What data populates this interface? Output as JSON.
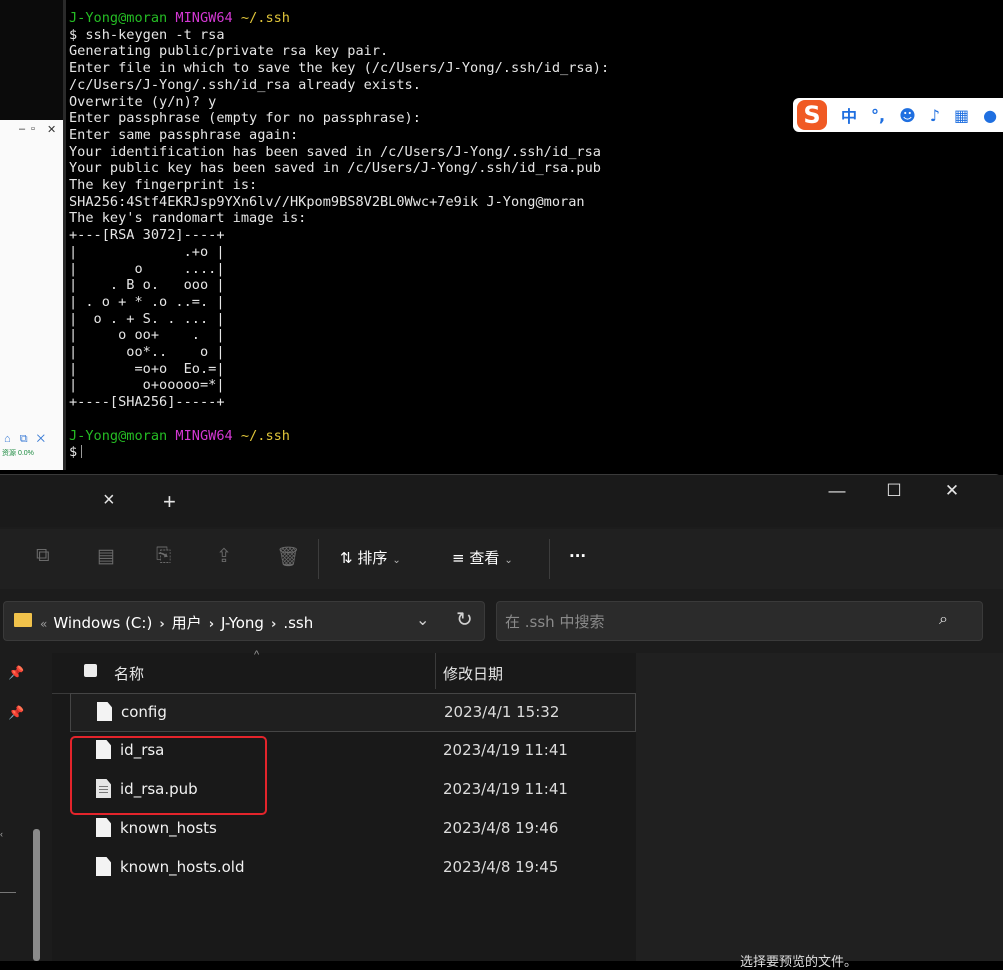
{
  "terminal": {
    "prompt_user": "J-Yong@moran",
    "prompt_host": "MINGW64",
    "prompt_path": "~/.ssh",
    "lines": [
      "$ ssh-keygen -t rsa",
      "Generating public/private rsa key pair.",
      "Enter file in which to save the key (/c/Users/J-Yong/.ssh/id_rsa):",
      "/c/Users/J-Yong/.ssh/id_rsa already exists.",
      "Overwrite (y/n)? y",
      "Enter passphrase (empty for no passphrase):",
      "Enter same passphrase again:",
      "Your identification has been saved in /c/Users/J-Yong/.ssh/id_rsa",
      "Your public key has been saved in /c/Users/J-Yong/.ssh/id_rsa.pub",
      "The key fingerprint is:",
      "SHA256:4Stf4EKRJsp9YXn6lv//HKpom9BS8V2BL0Wwc+7e9ik J-Yong@moran",
      "The key's randomart image is:",
      "+---[RSA 3072]----+",
      "|             .+o |",
      "|       o     ....|",
      "|    . B o.   ooo |",
      "| . o + * .o ..=. |",
      "|  o . + S. . ... |",
      "|     o oo+    .  |",
      "|      oo*..    o |",
      "|       =o+o  Eo.=|",
      "|        o+ooooo=*|",
      "+----[SHA256]-----+"
    ],
    "second_prompt_symbol": "$"
  },
  "ime": {
    "logo": "S",
    "mode": "中",
    "punct": "°,",
    "emoji_icon": "emoji-icon",
    "mic_icon": "microphone-icon",
    "keyboard_icon": "keyboard-icon"
  },
  "left_window": {
    "cpu": "资源 0.0%"
  },
  "explorer": {
    "tab_close": "×",
    "tab_new": "+",
    "window": {
      "minimize": "—",
      "maximize": "☐",
      "close": "✕"
    },
    "toolbar": {
      "sort_label": "排序",
      "view_label": "查看",
      "more_label": "···"
    },
    "breadcrumb": {
      "overflow": "«",
      "items": [
        "Windows (C:)",
        "用户",
        "J-Yong",
        ".ssh"
      ]
    },
    "search_placeholder": "在 .ssh 中搜索",
    "columns": {
      "name": "名称",
      "date": "修改日期"
    },
    "files": [
      {
        "name": "config",
        "date": "2023/4/1 15:32",
        "icon": "file-icon"
      },
      {
        "name": "id_rsa",
        "date": "2023/4/19 11:41",
        "icon": "file-icon"
      },
      {
        "name": "id_rsa.pub",
        "date": "2023/4/19 11:41",
        "icon": "text-file-icon"
      },
      {
        "name": "known_hosts",
        "date": "2023/4/8 19:46",
        "icon": "file-icon"
      },
      {
        "name": "known_hosts.old",
        "date": "2023/4/8 19:45",
        "icon": "file-icon"
      }
    ],
    "preview_hint": "选择要预览的文件。",
    "highlight_color": "#e3242b"
  }
}
